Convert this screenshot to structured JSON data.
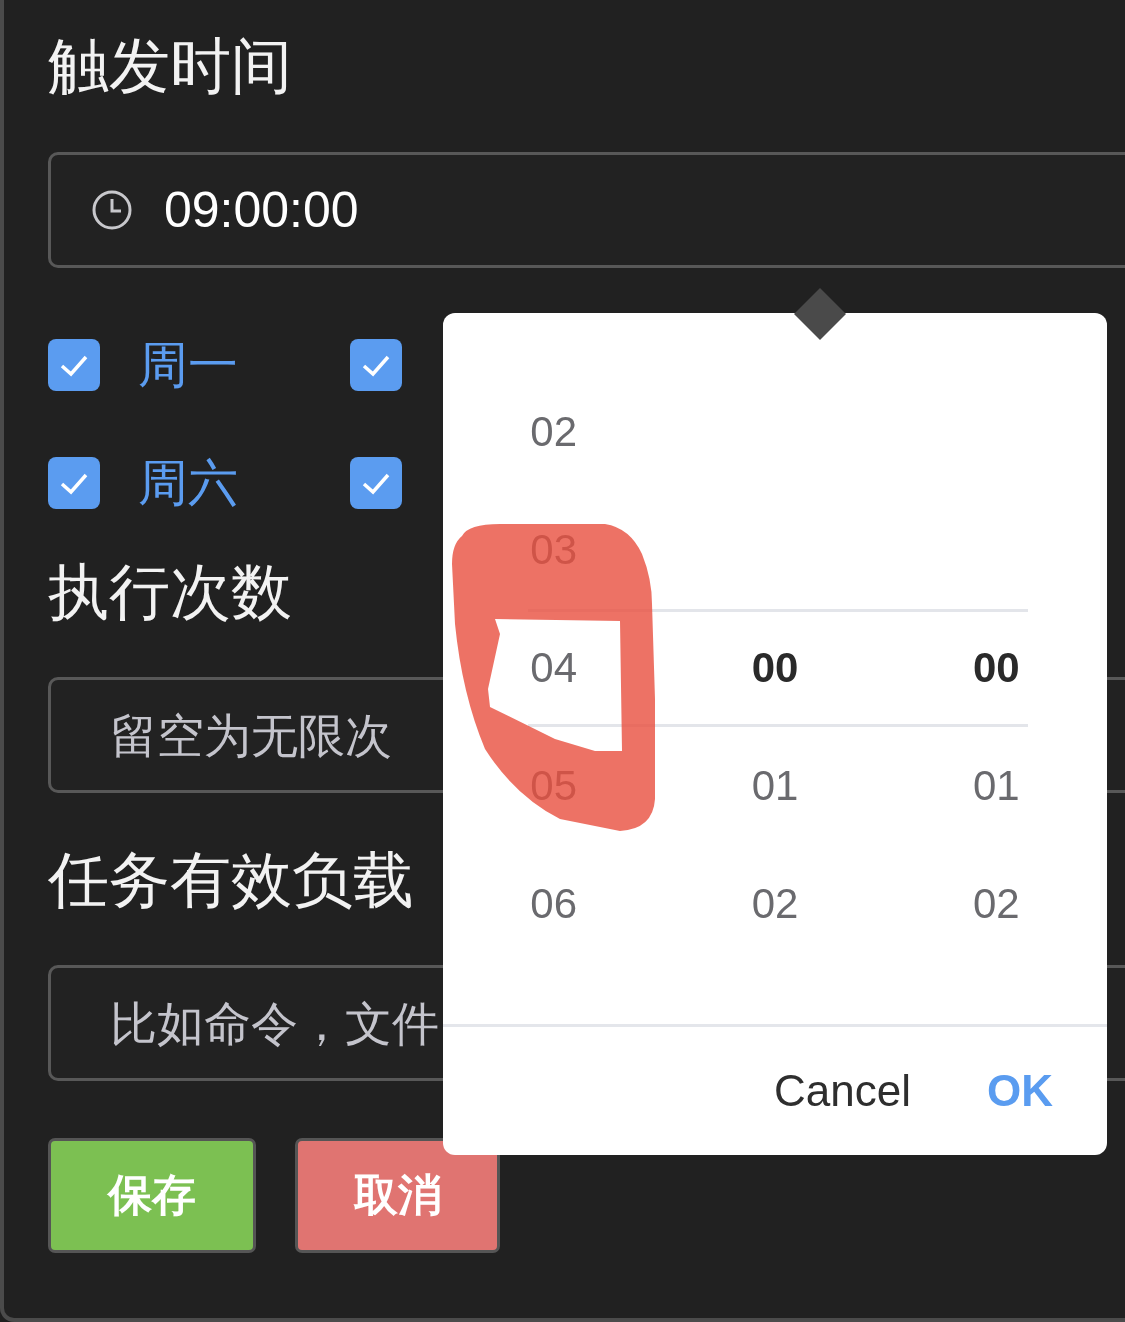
{
  "trigger_section": {
    "title": "触发时间",
    "time_field": {
      "value": "09:00:00"
    }
  },
  "weekdays": {
    "rows": [
      [
        {
          "label": "周一",
          "checked": true
        },
        {
          "checked": true
        }
      ],
      [
        {
          "label": "周六",
          "checked": true
        },
        {
          "checked": true
        }
      ]
    ]
  },
  "run_count_section": {
    "title": "执行次数",
    "field": {
      "placeholder": "留空为无限次"
    }
  },
  "payload_section": {
    "title": "任务有效负载",
    "field": {
      "placeholder": "比如命令，文件"
    }
  },
  "buttons": [
    {
      "kind": "primary",
      "label": "保存"
    },
    {
      "kind": "danger",
      "label": "取消"
    }
  ],
  "time_picker": {
    "rows": [
      {
        "cells": [
          {
            "text": "02",
            "selected": false
          }
        ]
      },
      {
        "cells": [
          {
            "text": "03",
            "selected": false
          }
        ]
      },
      {
        "cells": [
          {
            "text": "04",
            "selected": false
          },
          {
            "text": "00",
            "selected": true
          },
          {
            "text": "00",
            "selected": true
          }
        ]
      },
      {
        "cells": [
          {
            "text": "05",
            "selected": false
          },
          {
            "text": "01",
            "selected": false
          },
          {
            "text": "01",
            "selected": false
          }
        ]
      },
      {
        "cells": [
          {
            "text": "06",
            "selected": false
          },
          {
            "text": "02",
            "selected": false
          },
          {
            "text": "02",
            "selected": false
          }
        ]
      }
    ],
    "actions": [
      {
        "kind": "cancel",
        "label": "Cancel"
      },
      {
        "kind": "confirm",
        "label": "OK"
      }
    ]
  }
}
